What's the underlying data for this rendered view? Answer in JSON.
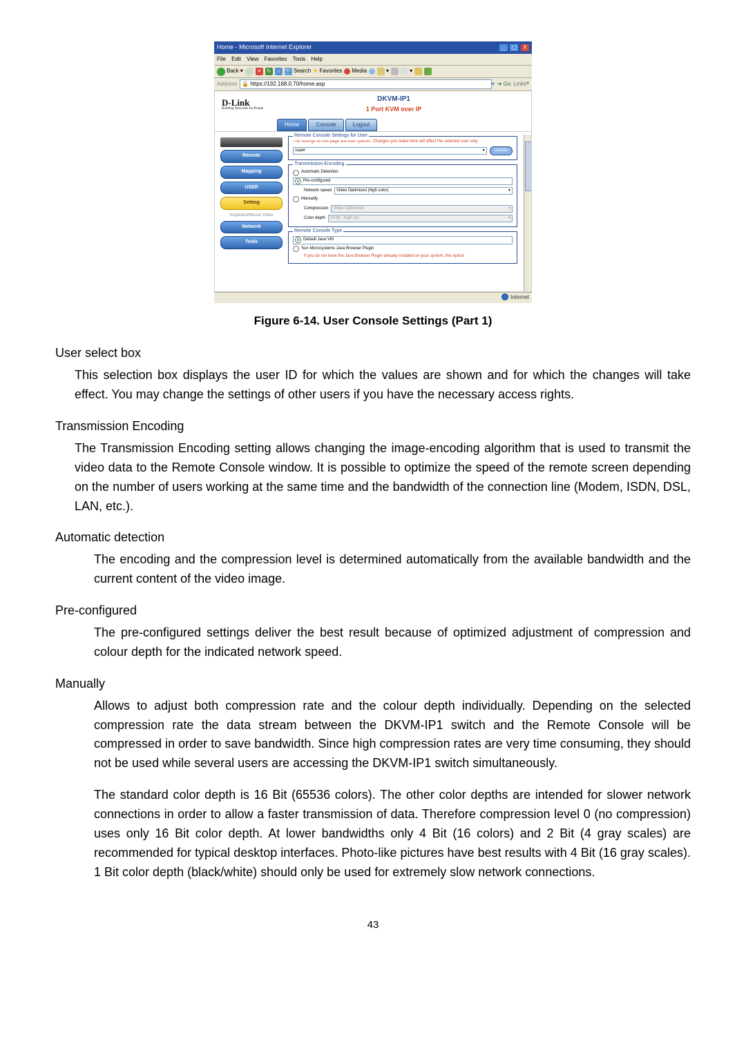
{
  "figure": {
    "titlebar": "Home - Microsoft Internet Explorer",
    "menubar": [
      "File",
      "Edit",
      "View",
      "Favorites",
      "Tools",
      "Help"
    ],
    "toolbar_back": "Back",
    "toolbar_search": "Search",
    "toolbar_favorites": "Favorites",
    "toolbar_media": "Media",
    "address_label": "Address",
    "url": "https://192.168.0.70/home.asp",
    "go_label": "Go",
    "links_label": "Links",
    "brand": "D-Link",
    "brand_sub": "Building Networks for People",
    "product": "DKVM-IP1",
    "subtitle": "1 Port KVM over IP",
    "tabs": [
      "Home",
      "Console",
      "Logout"
    ],
    "sidebar_top_img": true,
    "sidebar": [
      {
        "label": "Remote",
        "style": "blue"
      },
      {
        "label": "Mapping",
        "style": "blue"
      },
      {
        "label": "USER",
        "style": "blue"
      },
      {
        "label": "Setting",
        "style": "yellow"
      }
    ],
    "sidebar_plain": "Keyboard/Mouse\nVideo",
    "sidebar_bottom": [
      {
        "label": "Network",
        "style": "blue"
      },
      {
        "label": "Tools",
        "style": "blue"
      }
    ],
    "fs1_legend": "Remote Console Settings for User",
    "fs1_text": "The settings on this page are user specific. Changes you make here will affect the selected user only.",
    "fs1_select": "super",
    "fs1_btn": "Update",
    "fs2_legend": "Transmission Encoding",
    "fs2_r1": "Automatic Detection",
    "fs2_r2": "Pre-configured",
    "fs2_ns_label": "Network speed",
    "fs2_ns_value": "Video Optimized (high color)",
    "fs2_r3": "Manually",
    "fs2_comp_label": "Compression",
    "fs2_comp_value": "Video Optimized",
    "fs2_cd_label": "Color depth",
    "fs2_cd_value": "16 bit - high col",
    "fs3_legend": "Remote Console Type",
    "fs3_r1": "Default Java VM",
    "fs3_r2": "Sun Microsystems Java Browser Plugin",
    "fs3_note": "If you do not have the Java Browser Plugin already installed on your system, this option",
    "status": "Internet"
  },
  "caption": "Figure 6-14. User Console Settings (Part 1)",
  "sections": [
    {
      "h": "User select box",
      "level": 1,
      "body": "This selection box displays the user ID for which the values are shown and for which the changes will take effect. You may change the settings of other users if you have the necessary access rights."
    },
    {
      "h": "Transmission Encoding",
      "level": 1,
      "body": "The Transmission Encoding setting allows changing the image-encoding algorithm that is used to transmit the video data to the Remote Console window. It is possible to optimize the speed of the remote screen depending on the number of users working at the same time and the bandwidth of the connection line (Modem, ISDN, DSL, LAN, etc.)."
    },
    {
      "h": "Automatic detection",
      "level": 2,
      "body": "The encoding and the compression level is determined automatically from the available bandwidth and the current content of the video image."
    },
    {
      "h": "Pre-configured",
      "level": 2,
      "body": "The pre-configured settings deliver the best result because of optimized adjustment of compression and colour depth for the indicated network speed."
    },
    {
      "h": "Manually",
      "level": 2,
      "body": "Allows to adjust both compression rate and the colour depth individually. Depending on the selected compression rate the data stream between the DKVM-IP1 switch and the Remote Console will be compressed in order to save bandwidth. Since high compression rates are very time consuming, they should not be used while several users are accessing the DKVM-IP1 switch simultaneously."
    },
    {
      "h": "",
      "level": 2,
      "body": "The standard color depth is 16 Bit (65536 colors). The other color depths are intended for slower network connections in order to allow a faster transmission of data. Therefore compression level 0 (no compression) uses only 16 Bit color depth. At lower bandwidths only 4 Bit (16 colors) and 2 Bit (4 gray scales) are recommended for typical desktop interfaces. Photo-like pictures have best results with 4 Bit (16 gray scales). 1 Bit color depth (black/white) should only be used for extremely slow network connections."
    }
  ],
  "pagenum": "43"
}
